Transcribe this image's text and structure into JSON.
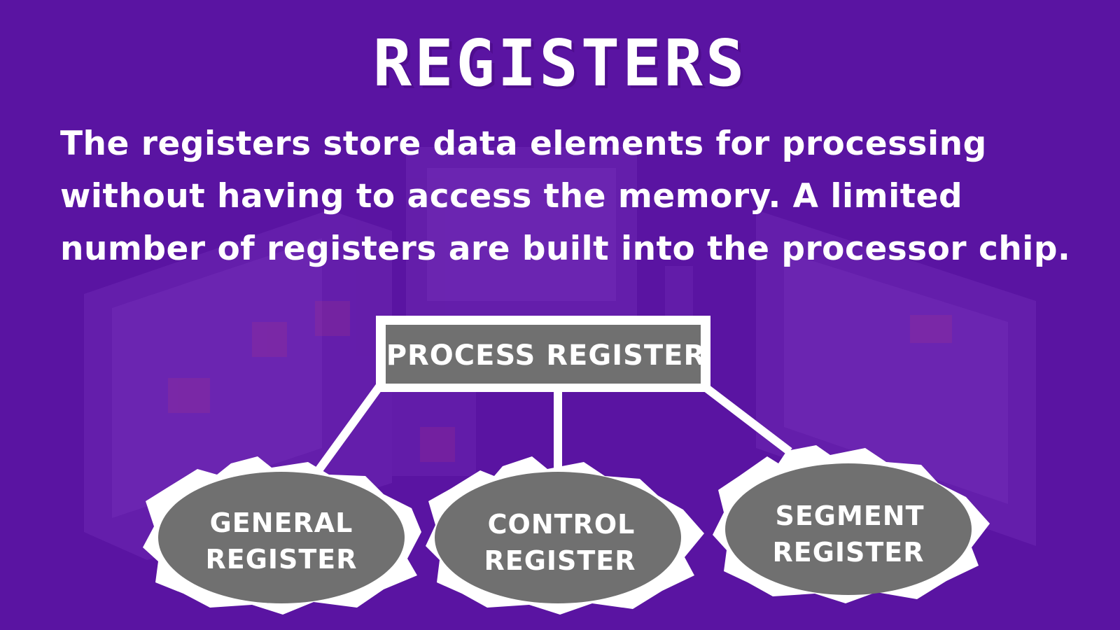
{
  "slide": {
    "title": "REGISTERS",
    "description": "The registers store data elements for processing without having to access the memory. A limited number of registers are built into the processor chip."
  },
  "diagram": {
    "root": "PROCESS REGISTER",
    "children": [
      {
        "line1": "GENERAL",
        "line2": "REGISTER"
      },
      {
        "line1": "CONTROL",
        "line2": "REGISTER"
      },
      {
        "line1": "SEGMENT",
        "line2": "REGISTER"
      }
    ]
  },
  "colors": {
    "background": "#5a14a2",
    "node_fill": "#707070",
    "node_border": "#ffffff",
    "text": "#ffffff"
  }
}
